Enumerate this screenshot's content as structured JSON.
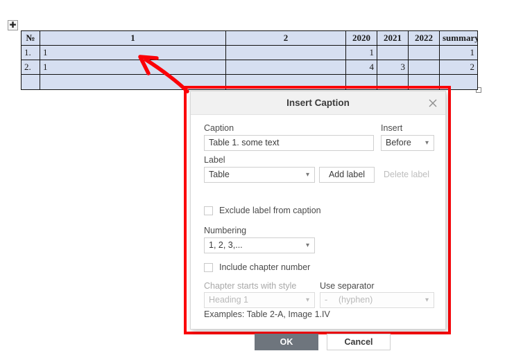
{
  "document": {
    "table": {
      "move_handle_icon": "move-cross-icon",
      "resize_handle_icon": "resize-square-icon",
      "headers": [
        "№",
        "1",
        "2",
        "2020",
        "2021",
        "2022",
        "summary"
      ],
      "rows": [
        [
          "1.",
          "1",
          "",
          "1",
          "",
          "",
          "1"
        ],
        [
          "2.",
          "1",
          "",
          "4",
          "3",
          "",
          "2"
        ],
        [
          "",
          "",
          "",
          "",
          "",
          "",
          ""
        ]
      ],
      "cell_fill_color": "#d6dff1",
      "border_color": "#111111"
    },
    "annotation": {
      "arrow_icon": "red-arrow-annotation",
      "highlight_box_icon": "red-highlight-rectangle",
      "color": "#fb0007"
    }
  },
  "dialog": {
    "title": "Insert Caption",
    "close_icon": "close-icon",
    "caption": {
      "label": "Caption",
      "value": "Table 1. some text",
      "placeholder": ""
    },
    "insert": {
      "label": "Insert",
      "value": "Before",
      "caret_icon": "chevron-down-icon"
    },
    "label_field": {
      "label": "Label",
      "value": "Table",
      "caret_icon": "chevron-down-icon"
    },
    "add_label_button": "Add label",
    "delete_label_button": "Delete label",
    "exclude_label_checkbox": {
      "label": "Exclude label from caption",
      "checked": false
    },
    "numbering": {
      "label": "Numbering",
      "value": "1, 2, 3,...",
      "caret_icon": "chevron-down-icon"
    },
    "include_chapter_checkbox": {
      "label": "Include chapter number",
      "checked": false
    },
    "chapter_style": {
      "label": "Chapter starts with style",
      "value": "Heading 1",
      "caret_icon": "chevron-down-icon",
      "disabled": true
    },
    "separator": {
      "label": "Use separator",
      "symbol": "-",
      "value": "(hyphen)",
      "caret_icon": "chevron-down-icon",
      "disabled": true
    },
    "examples": "Examples: Table 2-A, Image 1.IV",
    "ok_button": "OK",
    "cancel_button": "Cancel",
    "ok_button_color": "#6e757d"
  }
}
